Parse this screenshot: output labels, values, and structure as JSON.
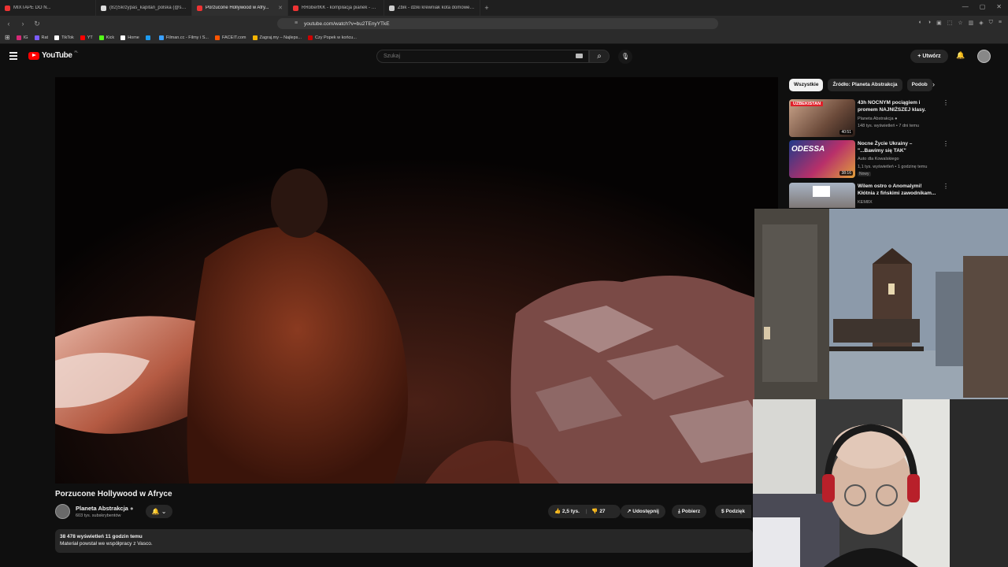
{
  "browser": {
    "tabs": [
      {
        "title": "MIXTAPE DO N...",
        "active": false
      },
      {
        "title": "(82)Skrzypas_kapitan_polska (@skrzy...",
        "active": false
      },
      {
        "title": "Porzucone Hollywood w Afry...",
        "active": true
      },
      {
        "title": "RRobertKK - kompilacja pianek - Yo...",
        "active": false
      },
      {
        "title": "Żbik - dziki krewniak kota domoweg...",
        "active": false
      }
    ],
    "url": "youtube.com/watch?v=bu2TEnyYTkE",
    "bookmarks": [
      {
        "label": "IG",
        "color": "#d62976"
      },
      {
        "label": "Rat",
        "color": "#7b5cff"
      },
      {
        "label": "TikTok",
        "color": "#ffffff"
      },
      {
        "label": "YT",
        "color": "#ff0000"
      },
      {
        "label": "Kick",
        "color": "#53fc18"
      },
      {
        "label": "Home",
        "color": "#ffffff"
      },
      {
        "label": "",
        "color": "#1d9bf0"
      },
      {
        "label": "Filman.cc - Filmy i S...",
        "color": "#3aa0ff"
      },
      {
        "label": "FACEIT.com",
        "color": "#ff5500"
      },
      {
        "label": "Zagraj.my – Najleps...",
        "color": "#f4b400"
      },
      {
        "label": "Czy Popek w końcu...",
        "color": "#cc0000"
      }
    ]
  },
  "youtube": {
    "logo_text": "YouTube",
    "logo_country": "PL",
    "search_placeholder": "Szukaj",
    "create_label": "Utwórz"
  },
  "video": {
    "title": "Porzucone Hollywood w Afryce",
    "channel": "Planeta Abstrakcja",
    "subscribers": "603 tys. subskrybentów",
    "likes": "2,5 tys.",
    "dislikes": "27",
    "share_label": "Udostępnij",
    "download_label": "Pobierz",
    "thanks_label": "Podzięk",
    "views_line": "38 478 wyświetleń  11 godzin temu",
    "description": "Materiał powstał we współpracy z Vasco."
  },
  "sidebar": {
    "chips": [
      "Wszystkie",
      "Źródło: Planeta Abstrakcja",
      "Podob"
    ],
    "recommendations": [
      {
        "title": "43h NOCNYM pociągiem i promem NAJNIŻSZEJ klasy.",
        "channel": "Planeta Abstrakcja",
        "meta": "148 tys. wyświetleń • 7 dni temu",
        "duration": "40:51",
        "thumb_label": "UZBEKISTAN",
        "is_new": false
      },
      {
        "title": "Nocne Życie Ukrainy – \"...Bawimy się TAK\"",
        "channel": "Auto dla Kowalskiego",
        "meta": "1,1 tys. wyświetleń • 1 godzinę temu",
        "duration": "38:16",
        "thumb_label": "ODESSA",
        "is_new": true,
        "new_label": "Nowy"
      },
      {
        "title": "Wilem ostro o Anomalymi! Kłótnia z fińskimi zawodnikam...",
        "channel": "KEM8X",
        "meta": "",
        "duration": "",
        "thumb_label": "",
        "is_new": false
      }
    ]
  }
}
